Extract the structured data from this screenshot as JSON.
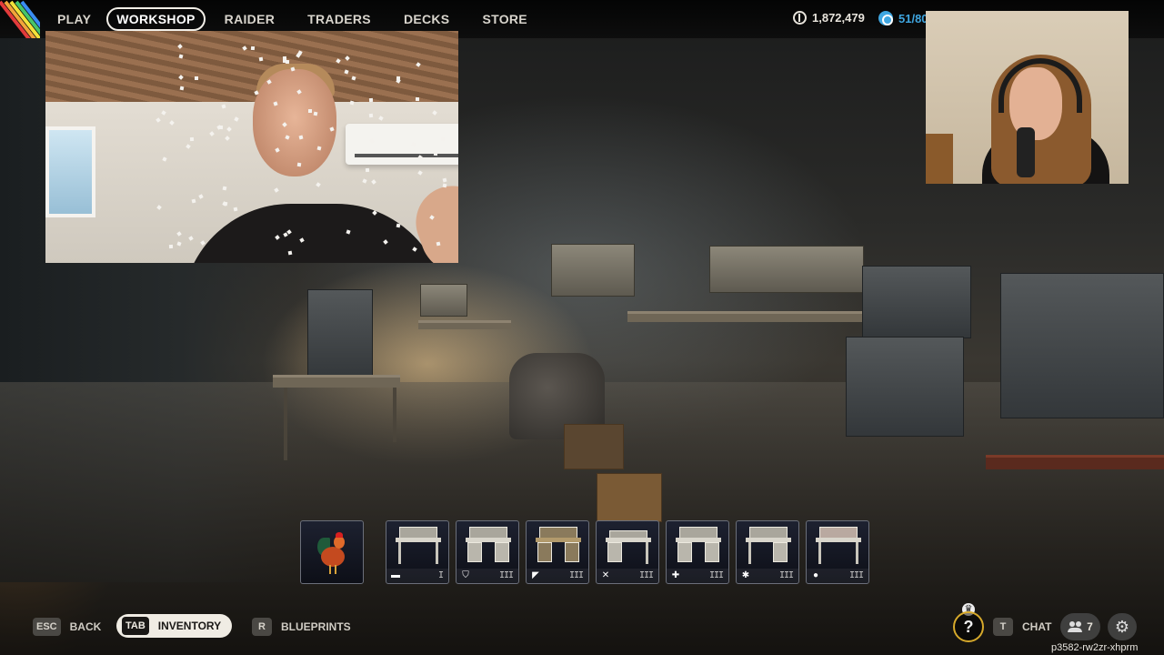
{
  "nav": {
    "items": [
      "PLAY",
      "WORKSHOP",
      "RAIDER",
      "TRADERS",
      "DECKS",
      "STORE"
    ],
    "active": "WORKSHOP"
  },
  "currency": {
    "coins": "1,872,479",
    "tokens": "51/80",
    "coin_icon": "coins-icon",
    "token_icon": "raider-token-icon",
    "token_color": "#3fa6e0"
  },
  "items": [
    {
      "name": "rooster",
      "icon": "rooster-icon",
      "level": ""
    },
    {
      "name": "workbench",
      "icon": "hammer-icon",
      "level": "I"
    },
    {
      "name": "gear-bench",
      "icon": "shield-icon",
      "level": "III"
    },
    {
      "name": "gunsmith",
      "icon": "gun-icon",
      "level": "III"
    },
    {
      "name": "refiner",
      "icon": "crossed-tools-icon",
      "level": "III"
    },
    {
      "name": "medical-lab",
      "icon": "medical-cross-icon",
      "level": "III"
    },
    {
      "name": "explosives-station",
      "icon": "explosive-icon",
      "level": "III"
    },
    {
      "name": "utility-station",
      "icon": "gadget-icon",
      "level": "III"
    }
  ],
  "bottom": {
    "back": {
      "key": "ESC",
      "label": "BACK"
    },
    "inventory": {
      "key": "TAB",
      "label": "INVENTORY"
    },
    "blueprints": {
      "key": "R",
      "label": "BLUEPRINTS"
    },
    "chat": {
      "key": "T",
      "label": "CHAT"
    },
    "party_count": "7",
    "help_label": "?",
    "session_id": "p3582-rw2zr-xhprm"
  },
  "colors": {
    "accent_ring": "#d6a92b",
    "pill_bg": "#f0ece4"
  }
}
